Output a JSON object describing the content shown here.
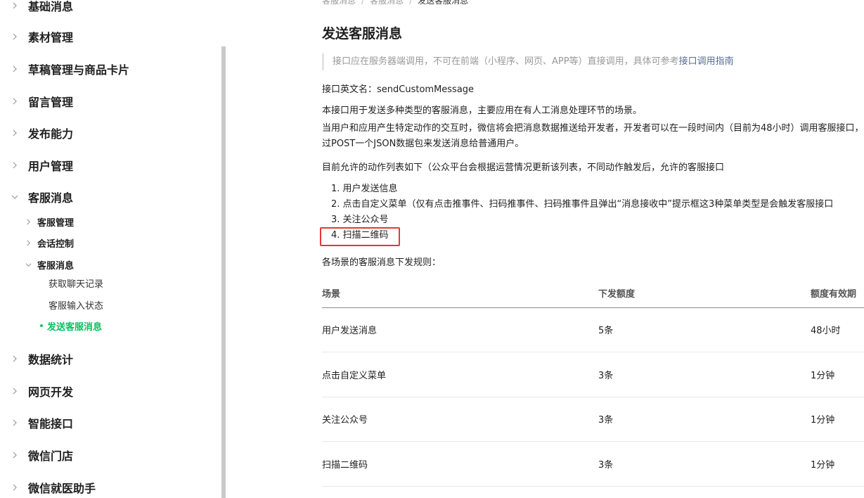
{
  "sidebar": {
    "top_items": [
      "基础消息",
      "素材管理",
      "草稿管理与商品卡片",
      "留言管理",
      "发布能力",
      "用户管理",
      "客服消息"
    ],
    "sub_items": [
      "客服管理",
      "会话控制",
      "客服消息"
    ],
    "leaf_items": [
      "获取聊天记录",
      "客服输入状态",
      "发送客服消息"
    ],
    "bottom_items": [
      "数据统计",
      "网页开发",
      "智能接口",
      "微信门店",
      "微信就医助手"
    ]
  },
  "main": {
    "breadcrumb": [
      "客服消息",
      "客服消息",
      "发送客服消息"
    ],
    "title": "发送客服消息",
    "notice_text": "接口应在服务器端调用，不可在前端（小程序、网页、APP等）直接调用，具体可参考",
    "notice_link": "接口调用指南",
    "api_name": "接口英文名：sendCustomMessage",
    "desc1": "本接口用于发送多种类型的客服消息，主要应用在有人工消息处理环节的场景。",
    "desc2": "当用户和应用产生特定动作的交互时，微信将会把消息数据推送给开发者，开发者可以在一段时间内（目前为48小时）调用客服接口，通过POST一个JSON数据包来发送消息给普通用户。",
    "desc3": "目前允许的动作列表如下（公众平台会根据运营情况更新该列表，不同动作触发后，允许的客服接口",
    "steps": [
      "1. 用户发送信息",
      "2. 点击自定义菜单（仅有点击推事件、扫码推事件、扫码推事件且弹出“消息接收中”提示框这3种菜单类型是会触发客服接口",
      "3. 关注公众号",
      "4. 扫描二维码"
    ],
    "rules_intro": "各场景的客服消息下发规则：",
    "table": {
      "headers": [
        "场景",
        "下发额度",
        "额度有效期"
      ],
      "rows": [
        [
          "用户发送消息",
          "5条",
          "48小时"
        ],
        [
          "点击自定义菜单",
          "3条",
          "1分钟"
        ],
        [
          "关注公众号",
          "3条",
          "1分钟"
        ],
        [
          "扫描二维码",
          "3条",
          "1分钟"
        ]
      ]
    }
  },
  "colors": {
    "accent": "#07c160",
    "link": "#576b95",
    "highlight": "#e53935"
  }
}
